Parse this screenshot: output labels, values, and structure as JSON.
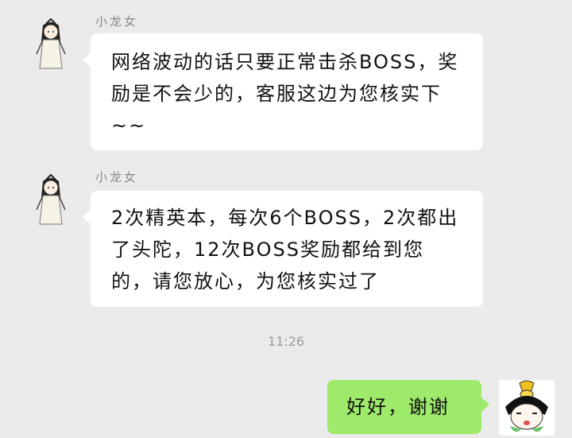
{
  "messages": [
    {
      "sender": "小龙女",
      "text": "网络波动的话只要正常击杀BOSS，奖励是不会少的，客服这边为您核实下~~"
    },
    {
      "sender": "小龙女",
      "text": "2次精英本，每次6个BOSS，2次都出了头陀，12次BOSS奖励都给到您的，请您放心，为您核实过了"
    }
  ],
  "timestamp": "11:26",
  "reply": {
    "text": "好好，谢谢"
  },
  "colors": {
    "background": "#ebebeb",
    "incoming_bubble": "#ffffff",
    "outgoing_bubble": "#9eea6a"
  }
}
